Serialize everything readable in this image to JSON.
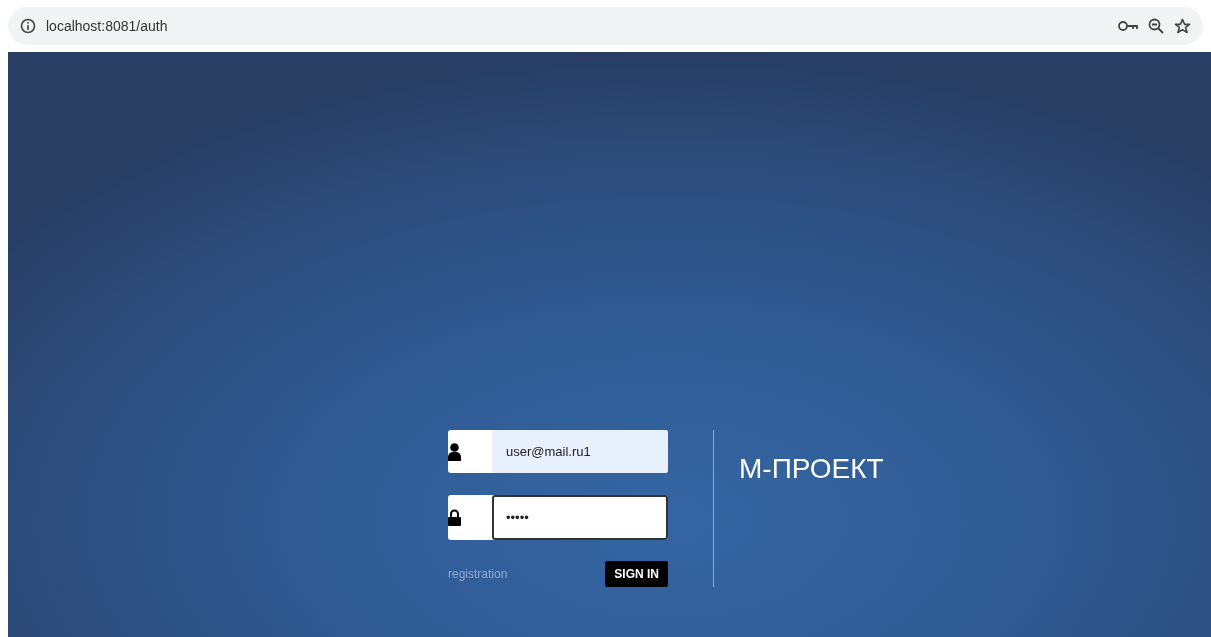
{
  "browser": {
    "address": "localhost:8081/auth"
  },
  "login": {
    "fields": [
      {
        "kind": "user",
        "value": "user@mail.ru1",
        "focused": false
      },
      {
        "kind": "password",
        "value": "•••••",
        "focused": true
      }
    ],
    "registration_link": "registration",
    "sign_in_button": "SIGN IN"
  },
  "brand": {
    "title": "М-ПРОЕКТ"
  }
}
